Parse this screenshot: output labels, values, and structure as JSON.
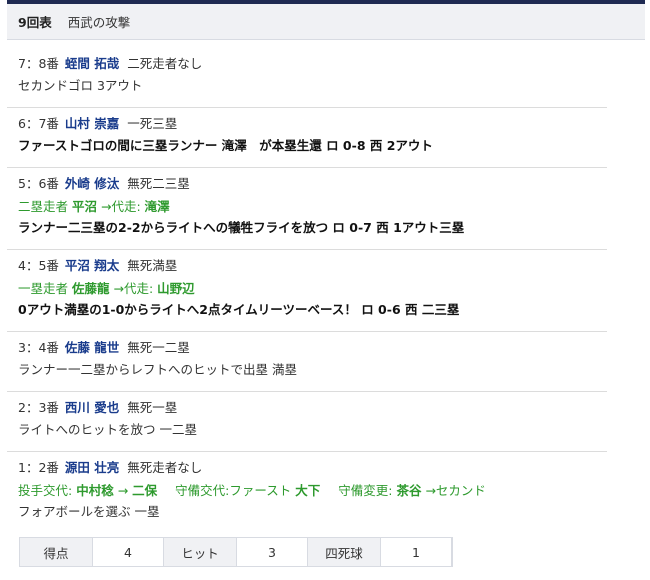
{
  "header": {
    "inning": "9回表",
    "team_attack": "西武の攻撃"
  },
  "plays": [
    {
      "order": "7：8番",
      "player": "蛭間 拓哉",
      "situation": "二死走者なし",
      "result": "セカンドゴロ 3アウト"
    },
    {
      "order": "6：7番",
      "player": "山村 崇嘉",
      "situation": "一死三塁",
      "result": "ファーストゴロの間に三塁ランナー 滝澤　が本塁生還 ロ 0-8 西 2アウト"
    },
    {
      "order": "5：6番",
      "player": "外崎 修汰",
      "situation": "無死二三塁",
      "sub": {
        "prefix": "二塁走者",
        "from": "平沼",
        "arrow": "→代走:",
        "to": "滝澤"
      },
      "result": "ランナー二三塁の2-2からライトへの犠牲フライを放つ ロ 0-7 西 1アウト三塁"
    },
    {
      "order": "4：5番",
      "player": "平沼 翔太",
      "situation": "無死満塁",
      "sub": {
        "prefix": "一塁走者",
        "from": "佐藤龍",
        "arrow": "→代走:",
        "to": "山野辺"
      },
      "result": "0アウト満塁の1-0からライトへ2点タイムリーツーベース！ ロ 0-6 西 二三塁"
    },
    {
      "order": "3：4番",
      "player": "佐藤 龍世",
      "situation": "無死一二塁",
      "result": "ランナー一二塁からレフトへのヒットで出塁 満塁"
    },
    {
      "order": "2：3番",
      "player": "西川 愛也",
      "situation": "無死一塁",
      "result": "ライトへのヒットを放つ 一二塁"
    },
    {
      "order": "1：2番",
      "player": "源田 壮亮",
      "situation": "無死走者なし",
      "changes": [
        {
          "prefix": "投手交代:",
          "from": "中村稔",
          "arrow": "→",
          "to": "二保"
        },
        {
          "prefix": "守備交代:ファースト",
          "to": "大下"
        },
        {
          "prefix": "守備変更:",
          "to": "茶谷",
          "suffix": "→セカンド"
        }
      ],
      "result": "フォアボールを選ぶ 一塁"
    }
  ],
  "summary": {
    "runs_label": "得点",
    "runs": "4",
    "hits_label": "ヒット",
    "hits": "3",
    "walks_label": "四死球",
    "walks": "1"
  }
}
